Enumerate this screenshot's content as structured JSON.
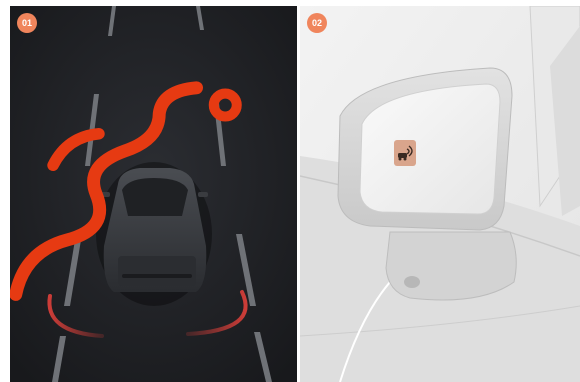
{
  "panels": [
    {
      "badge": "01"
    },
    {
      "badge": "02"
    }
  ],
  "colors": {
    "badge": "#F0855C",
    "accent_red": "#E0403A",
    "road": "#23252A",
    "lane": "#7A7D82",
    "mirror_icon_bg": "#D9A58C",
    "watermark": "#E63A12"
  },
  "icons": {
    "blind_spot_indicator": "bliss-car-wave-icon"
  }
}
